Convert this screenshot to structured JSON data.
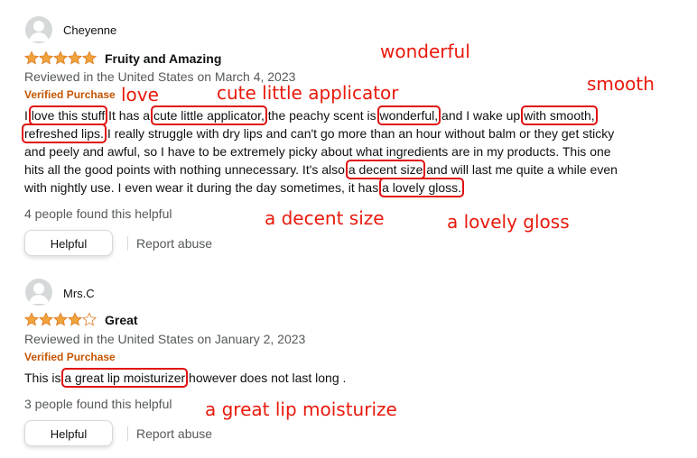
{
  "colors": {
    "star_fill": "#f1a33c",
    "star_empty": "#ffffff",
    "verified": "#c45500",
    "highlight_box": "#e01010",
    "annotation": "#e8190c",
    "muted_text": "#565959"
  },
  "reviews": [
    {
      "reviewer": "Cheyenne",
      "rating": 5,
      "title": "Fruity and Amazing",
      "reviewed_meta": "Reviewed in the United States on March 4, 2023",
      "verified": "Verified Purchase",
      "body_lines": [
        [
          "I ",
          {
            "hl": "love this stuff"
          },
          " It has a ",
          {
            "hl": "cute little applicator,"
          },
          " the peachy scent is ",
          {
            "hl": "wonderful,"
          },
          " and I wake up ",
          {
            "hl": "with smooth,"
          }
        ],
        [
          {
            "hl": "refreshed lips."
          },
          " I really struggle with dry lips and can't go more than an hour without balm or they get sticky"
        ],
        [
          "and peely and awful, so I have to be extremely picky about what ingredients are in my products. This one"
        ],
        [
          "hits all the good points with nothing unnecessary. It's also ",
          {
            "hl": "a decent size"
          },
          " and will last me quite a while even"
        ],
        [
          "with nightly use. I even wear it during the day sometimes, it has ",
          {
            "hl": "a lovely gloss."
          }
        ]
      ],
      "helpful_count": "4 people found this helpful",
      "helpful_label": "Helpful",
      "report_label": "Report abuse"
    },
    {
      "reviewer": "Mrs.C",
      "rating": 4,
      "title": "Great",
      "reviewed_meta": "Reviewed in the United States on January 2, 2023",
      "verified": "Verified Purchase",
      "body_lines": [
        [
          "This is ",
          {
            "hl": "a great lip moisturizer"
          },
          " however does not last long ."
        ]
      ],
      "helpful_count": "3 people found this helpful",
      "helpful_label": "Helpful",
      "report_label": "Report abuse"
    }
  ],
  "annotations": {
    "love": "love",
    "cute_little_applicator": "cute little applicator",
    "wonderful": "wonderful",
    "smooth": "smooth",
    "decent_size": "a decent size",
    "lovely_gloss": "a lovely gloss",
    "great_lip_moisturize": "a great lip moisturize"
  }
}
